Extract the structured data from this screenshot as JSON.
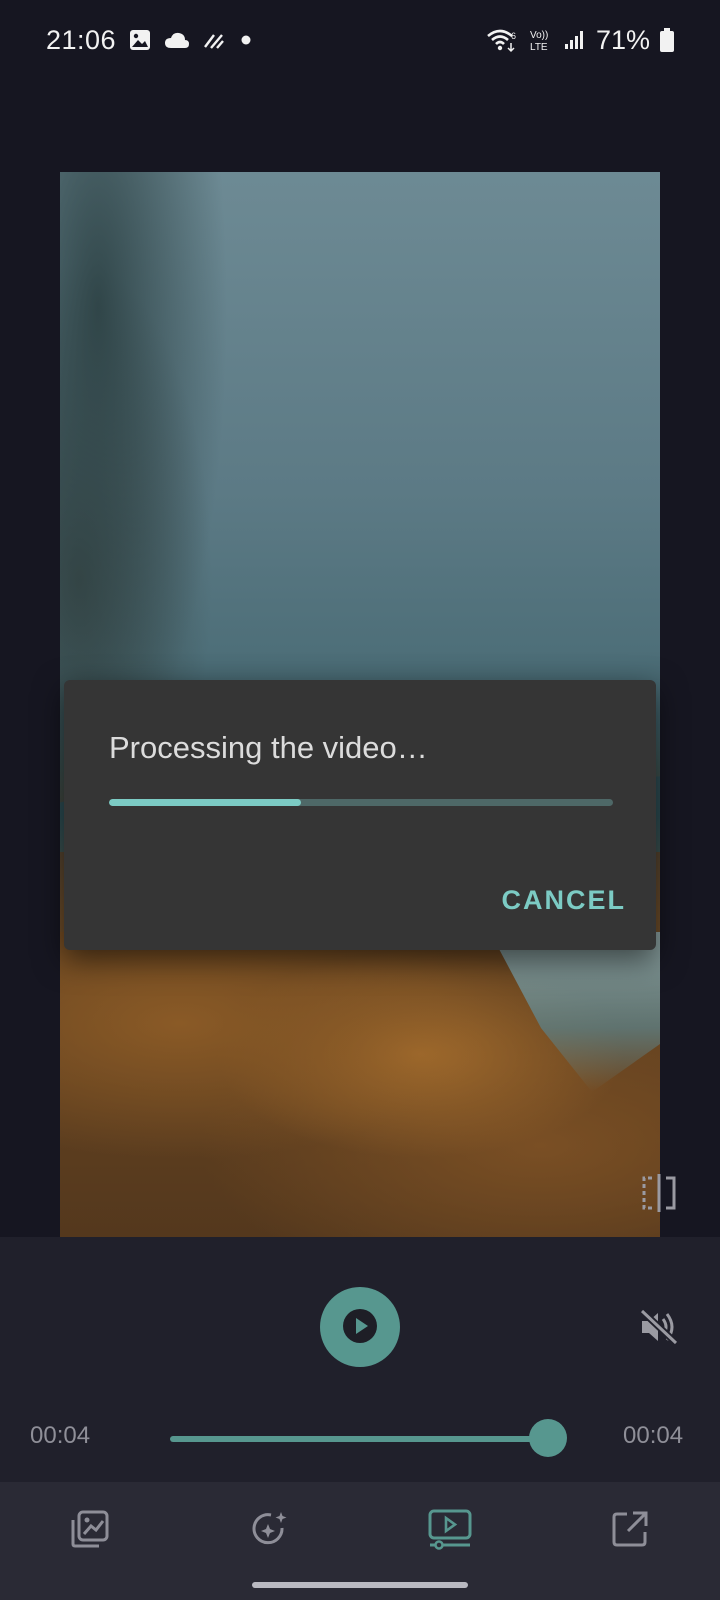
{
  "status_bar": {
    "time": "21:06",
    "battery": "71%",
    "left_icons": [
      "gallery-icon",
      "cloud-icon",
      "data-saver-icon",
      "dot-icon"
    ],
    "right_icons": [
      "wifi-icon",
      "volte-icon",
      "signal-icon",
      "battery-icon"
    ]
  },
  "dialog": {
    "title": "Processing the video…",
    "progress_fraction": 0.38,
    "cancel_label": "CANCEL"
  },
  "player": {
    "current_time": "00:04",
    "total_time": "00:04",
    "seek_fraction": 1.0,
    "play_icon": "play-icon",
    "mute_icon": "volume-off-icon",
    "compare_icon": "compare-icon"
  },
  "bottom_nav": {
    "items": [
      {
        "icon": "image-edit-icon",
        "active": false
      },
      {
        "icon": "magic-filter-icon",
        "active": false
      },
      {
        "icon": "video-preview-icon",
        "active": true
      },
      {
        "icon": "share-export-icon",
        "active": false
      }
    ]
  },
  "colors": {
    "accent": "#7ccbc4",
    "accent_dark": "#57978f",
    "background": "#161621",
    "dialog": "#353535",
    "nav_background": "#2a2a35",
    "inactive_icon": "#8e8e98"
  }
}
